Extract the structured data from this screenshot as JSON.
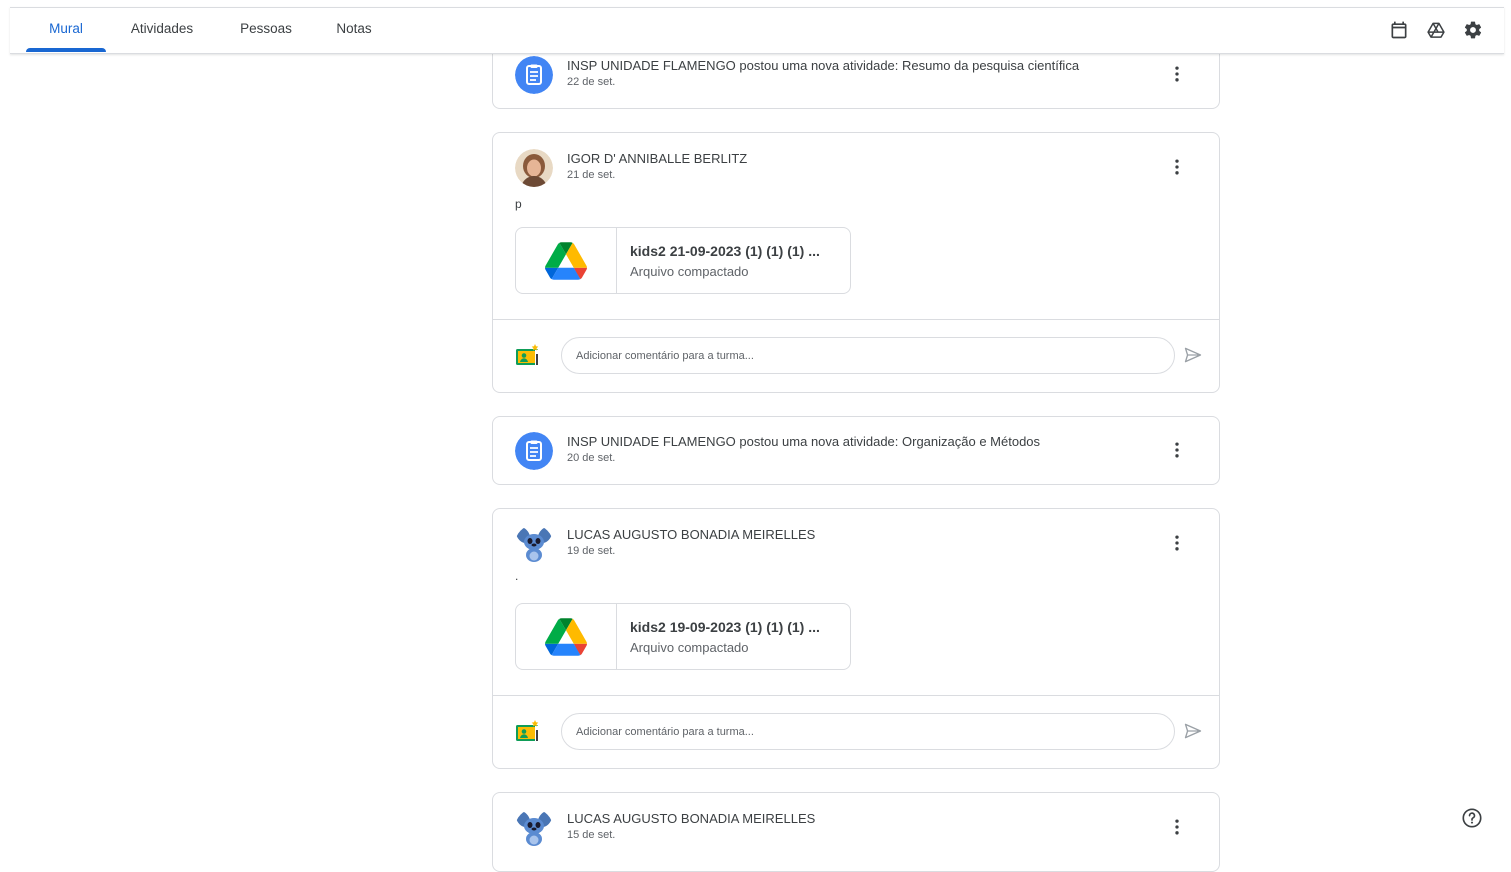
{
  "nav": {
    "tabs": [
      {
        "label": "Mural",
        "active": true
      },
      {
        "label": "Atividades",
        "active": false
      },
      {
        "label": "Pessoas",
        "active": false
      },
      {
        "label": "Notas",
        "active": false
      }
    ],
    "icons": [
      "calendar-icon",
      "google-drive-icon",
      "settings-icon"
    ]
  },
  "posts": [
    {
      "type": "assignment",
      "author": "INSP UNIDADE FLAMENGO postou uma nova atividade: Resumo da pesquisa científica",
      "date": "22 de set."
    },
    {
      "type": "announcement",
      "author": "IGOR D' ANNIBALLE BERLITZ",
      "date": "21 de set.",
      "text": "p",
      "attachment": {
        "name": "kids2 21-09-2023 (1) (1) (1) ...",
        "type": "Arquivo compactado"
      },
      "comment_placeholder": "Adicionar comentário para a turma..."
    },
    {
      "type": "assignment",
      "author": "INSP UNIDADE FLAMENGO postou uma nova atividade: Organização e Métodos",
      "date": "20 de set."
    },
    {
      "type": "announcement",
      "author": "LUCAS AUGUSTO BONADIA MEIRELLES",
      "date": "19 de set.",
      "text": ".",
      "attachment": {
        "name": "kids2 19-09-2023 (1) (1) (1) ...",
        "type": "Arquivo compactado"
      },
      "comment_placeholder": "Adicionar comentário para a turma..."
    },
    {
      "type": "announcement",
      "author": "LUCAS AUGUSTO BONADIA MEIRELLES",
      "date": "15 de set."
    }
  ],
  "colors": {
    "accent": "#1967d2",
    "assignment_icon_bg": "#4285f4",
    "border": "#dadce0",
    "text_secondary": "#5f6368"
  },
  "help_icon": "help-circle-icon"
}
